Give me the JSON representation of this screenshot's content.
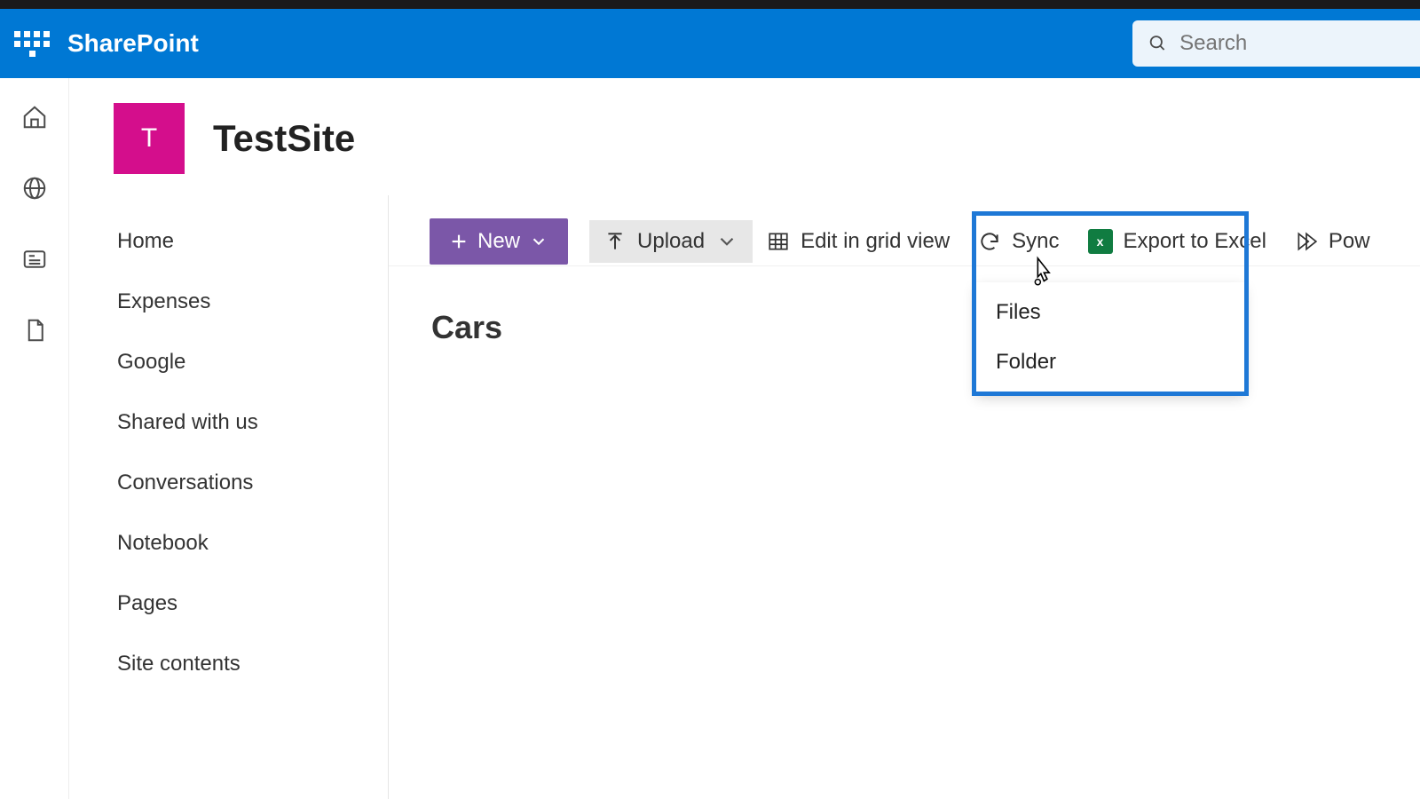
{
  "brand": "SharePoint",
  "search": {
    "placeholder": "Search"
  },
  "site": {
    "initial": "T",
    "title": "TestSite"
  },
  "left_nav": {
    "items": [
      {
        "label": "Home"
      },
      {
        "label": "Expenses"
      },
      {
        "label": "Google"
      },
      {
        "label": "Shared with us"
      },
      {
        "label": "Conversations"
      },
      {
        "label": "Notebook"
      },
      {
        "label": "Pages"
      },
      {
        "label": "Site contents"
      }
    ]
  },
  "commandbar": {
    "new_label": "New",
    "upload_label": "Upload",
    "edit_grid_label": "Edit in grid view",
    "sync_label": "Sync",
    "export_excel_label": "Export to Excel",
    "power_label": "Pow"
  },
  "upload_menu": {
    "files": "Files",
    "folder": "Folder"
  },
  "library": {
    "title": "Cars"
  },
  "colors": {
    "brand_blue": "#0078d4",
    "accent_purple": "#7b57a8",
    "site_magenta": "#d40e8c",
    "highlight_blue": "#1e78d6",
    "excel_green": "#107c41"
  }
}
